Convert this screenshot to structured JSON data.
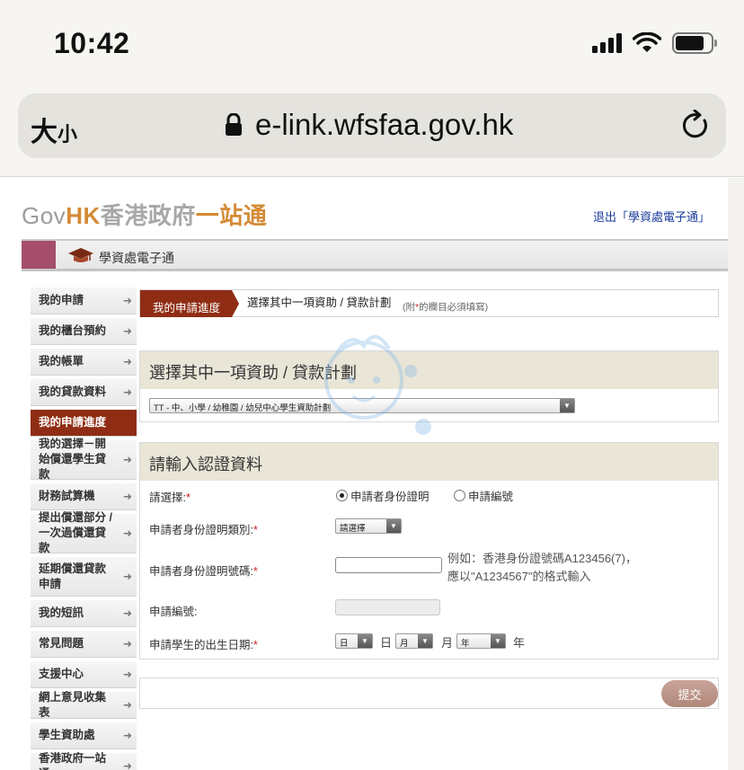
{
  "status_bar": {
    "time": "10:42"
  },
  "browser": {
    "text_size_label": "大",
    "text_size_small": "小",
    "url": "e-link.wfsfaa.gov.hk"
  },
  "header": {
    "logo_gov": "Gov",
    "logo_hk": "HK",
    "logo_zh": "香港政府",
    "logo_one": "一站通",
    "logout_link": "退出「學資處電子通」",
    "service_title": "學資處電子通"
  },
  "sidebar": {
    "items": [
      {
        "label": "我的申請"
      },
      {
        "label": "我的櫃台預約"
      },
      {
        "label": "我的帳單"
      },
      {
        "label": "我的貸款資料"
      },
      {
        "label": "我的申請進度"
      },
      {
        "label": "我的選擇－開始償還學生貸款"
      },
      {
        "label": "財務試算機"
      },
      {
        "label": "提出償還部分 / 一次過償還貸款"
      },
      {
        "label": "延期償還貸款申請"
      },
      {
        "label": "我的短訊"
      },
      {
        "label": "常見問題"
      },
      {
        "label": "支援中心"
      },
      {
        "label": "網上意見收集表"
      },
      {
        "label": "學生資助處"
      },
      {
        "label": "香港政府一站通"
      }
    ],
    "arrow": "➜"
  },
  "steps": {
    "current": "我的申請進度",
    "next": "選擇其中一項資助 / 貸款計劃",
    "note_prefix": "(附",
    "note_star": "*",
    "note_suffix": "的欄目必須填寫)"
  },
  "scheme_panel": {
    "title": "選擇其中一項資助 / 貸款計劃",
    "selected_scheme": "TT - 中、小學 / 幼稚園 / 幼兒中心學生資助計劃"
  },
  "auth_panel": {
    "title": "請輸入認證資料",
    "choose_label": "請選擇:",
    "radio_id": "申請者身份證明",
    "radio_appno": "申請編號",
    "id_type_label": "申請者身份證明類別:",
    "id_type_value": "請選擇",
    "id_number_label": "申請者身份證明號碼:",
    "id_hint_1": "例如：香港身份證號碼A123456(7)，",
    "id_hint_2": "應以\"A1234567\"的格式輸入",
    "app_no_label": "申請編號:",
    "dob_label": "申請學生的出生日期:",
    "dob_day": "日",
    "dob_month": "月",
    "dob_year": "年",
    "unit_day": "日",
    "unit_month": "月",
    "unit_year": "年",
    "star": "*",
    "dropdown": "▼"
  },
  "submit": {
    "label": "提交"
  },
  "colors": {
    "accent": "#8f2d14",
    "banner": "#a44e6c",
    "gov_orange": "#d58b37",
    "panel_head": "#e9e5d7"
  }
}
